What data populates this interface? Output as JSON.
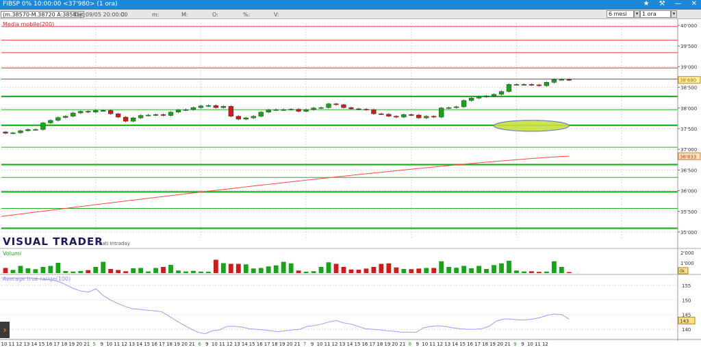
{
  "titlebar": {
    "title": "FIBSP 0%  10:00:00  <37'980>  (1 ora)",
    "icons": [
      "star-icon",
      "wrench-icon",
      "minimize-icon",
      "close-icon"
    ]
  },
  "toolbar": {
    "info": "(m.38570-M.38720 A:38585)",
    "date": "Dat:09/05 20:00:00",
    "fields": [
      "C:",
      "m:",
      "M:",
      "O:",
      "%:",
      "V:"
    ],
    "period": "6 mesi",
    "timeframe": "1 ora"
  },
  "colors": {
    "up": "#16a516",
    "down": "#d41919",
    "ma": "#ff4444",
    "support": "#22b022",
    "resistance": "#e03030",
    "atr": "#9b9bff",
    "highlight": "#c8e040"
  },
  "labels": {
    "ma": "Media mobile(200)",
    "brand": "VISUAL TRADER",
    "brand_sub": "Dati Intraday",
    "volume": "Volumi",
    "atr": "Average true range(100)",
    "last_price": "38'680",
    "ma_value": "36'833",
    "vol_value": "0k",
    "atr_value": "143"
  },
  "chart_data": [
    {
      "type": "candlestick",
      "title": "",
      "ylim": [
        34850,
        40050
      ],
      "yticks": [
        "35'000",
        "35'500",
        "36'000",
        "36'500",
        "37'000",
        "37'500",
        "38'000",
        "38'500",
        "39'000",
        "39'500",
        "40'000"
      ],
      "ytick_values": [
        35000,
        35500,
        36000,
        36500,
        37000,
        37500,
        38000,
        38500,
        39000,
        39500,
        40000
      ],
      "grid": true,
      "last_price": 38680,
      "close": [
        37390,
        37400,
        37450,
        37480,
        37480,
        37640,
        37700,
        37770,
        37800,
        37880,
        37920,
        37900,
        37940,
        37940,
        37860,
        37780,
        37680,
        37760,
        37820,
        37830,
        37840,
        37820,
        37900,
        37950,
        37960,
        38010,
        38050,
        38060,
        38010,
        38040,
        37800,
        37730,
        37760,
        37800,
        37900,
        37950,
        37960,
        37960,
        37970,
        37920,
        37960,
        38000,
        38010,
        38100,
        38080,
        38010,
        37980,
        37970,
        37960,
        37860,
        37850,
        37800,
        37780,
        37840,
        37830,
        37760,
        37800,
        37780,
        38000,
        38010,
        38030,
        38180,
        38240,
        38270,
        38290,
        38330,
        38400,
        38570,
        38570,
        38570,
        38560,
        38540,
        38620,
        38690,
        38690,
        38680
      ],
      "resistance_levels": [
        39970,
        39640,
        39340,
        38970,
        38700
      ],
      "support_levels": [
        38280,
        37960,
        37580,
        37050,
        36630,
        36320,
        35970,
        35570,
        35090
      ],
      "ma200": {
        "start": 35300,
        "end": 36833
      },
      "highlight_zone": {
        "x_start_bar": 65,
        "x_end_bar": 75,
        "center": 37570
      }
    },
    {
      "type": "bar",
      "title": "Volumi",
      "values": [
        500,
        310,
        700,
        460,
        380,
        600,
        700,
        1000,
        200,
        150,
        200,
        290,
        600,
        1100,
        400,
        300,
        180,
        470,
        500,
        160,
        500,
        600,
        800,
        250,
        160,
        220,
        150,
        140,
        1300,
        970,
        900,
        900,
        850,
        450,
        500,
        650,
        750,
        1100,
        950,
        250,
        140,
        180,
        600,
        1050,
        900,
        600,
        350,
        330,
        440,
        600,
        900,
        950,
        550,
        400,
        380,
        440,
        500,
        500,
        1150,
        600,
        520,
        700,
        470,
        700,
        400,
        780,
        950,
        1200,
        250,
        160,
        180,
        120,
        150,
        1150,
        600,
        100
      ],
      "yticks": [
        "1'000",
        "2'000"
      ],
      "ytick_values": [
        1000,
        2000
      ]
    },
    {
      "type": "line",
      "title": "Average true range(100)",
      "ylim": [
        137,
        158
      ],
      "yticks": [
        "140",
        "145",
        "150",
        "155"
      ],
      "ytick_values": [
        140,
        145,
        150,
        155
      ],
      "values": [
        157.5,
        157.5,
        157.5,
        157.5,
        157.5,
        157.2,
        157.0,
        156.8,
        156.2,
        155.0,
        153.8,
        153.0,
        152.7,
        153.8,
        151.5,
        150.0,
        148.8,
        147.8,
        147.0,
        146.8,
        146.5,
        146.3,
        146.0,
        144.5,
        143.0,
        141.5,
        140.2,
        139.0,
        138.5,
        139.5,
        139.8,
        141.0,
        141.0,
        140.8,
        140.2,
        140.0,
        139.8,
        139.5,
        139.2,
        139.5,
        139.8,
        140.0,
        141.0,
        141.3,
        141.8,
        142.5,
        143.0,
        142.2,
        141.8,
        141.0,
        140.2,
        140.0,
        139.8,
        139.5,
        139.3,
        139.0,
        139.0,
        139.0,
        140.5,
        141.0,
        141.2,
        141.0,
        140.5,
        140.2,
        140.0,
        140.0,
        140.2,
        141.0,
        142.8,
        143.5,
        143.5,
        143.2,
        143.2,
        143.5,
        144.0,
        144.8,
        145.2,
        145.0,
        143.5
      ],
      "last_value": 143
    }
  ],
  "x_axis": {
    "labels": [
      "10",
      "11",
      "12",
      "13",
      "14",
      "15",
      "16",
      "17",
      "18",
      "19",
      "20",
      "21",
      "5",
      "9",
      "10",
      "11",
      "12",
      "13",
      "14",
      "15",
      "16",
      "17",
      "18",
      "19",
      "20",
      "21",
      "6",
      "9",
      "10",
      "11",
      "12",
      "13",
      "14",
      "15",
      "16",
      "17",
      "18",
      "19",
      "20",
      "21",
      "7",
      "9",
      "10",
      "11",
      "12",
      "13",
      "14",
      "15",
      "16",
      "17",
      "18",
      "19",
      "20",
      "21",
      "8",
      "9",
      "10",
      "11",
      "12",
      "13",
      "14",
      "15",
      "16",
      "17",
      "18",
      "19",
      "20",
      "21",
      "9",
      "9",
      "10",
      "11",
      "12"
    ],
    "day_markers": [
      "5",
      "6",
      "7",
      "8",
      "9"
    ]
  }
}
